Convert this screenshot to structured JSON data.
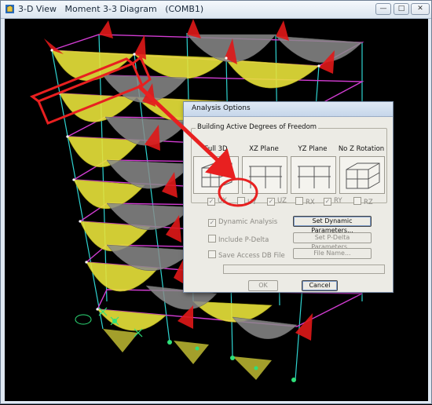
{
  "window": {
    "title": "3-D View   Moment 3-3 Diagram   (COMB1)",
    "minimize": "—",
    "maximize": "□",
    "close": "✕"
  },
  "dialog": {
    "title": "Analysis Options",
    "group_title": "Building Active Degrees of Freedom",
    "options": [
      {
        "label": "Full 3D"
      },
      {
        "label": "XZ Plane"
      },
      {
        "label": "YZ Plane"
      },
      {
        "label": "No Z Rotation"
      }
    ],
    "dofs": [
      {
        "label": "UX",
        "checked": true
      },
      {
        "label": "UY",
        "checked": false
      },
      {
        "label": "UZ",
        "checked": true
      },
      {
        "label": "RX",
        "checked": false
      },
      {
        "label": "RY",
        "checked": true
      },
      {
        "label": "RZ",
        "checked": false
      }
    ],
    "dynamic_analysis": {
      "label": "Dynamic Analysis",
      "checked": true
    },
    "include_pdelta": {
      "label": "Include P-Delta",
      "checked": false
    },
    "save_access": {
      "label": "Save Access DB File",
      "checked": false
    },
    "set_dynamic_button": "Set Dynamic Parameters...",
    "set_pdelta_button": "Set P-Delta Parameters...",
    "file_name_button": "File Name...",
    "ok_button": "OK",
    "cancel_button": "Cancel"
  },
  "colors": {
    "diagram_yellow": "#e8e23a",
    "diagram_gray": "#8a8a8a",
    "diagram_red": "#e01818",
    "frame_cyan": "#2fd3d0",
    "beam_magenta": "#d23cd2",
    "annotation_red": "#e82020"
  }
}
